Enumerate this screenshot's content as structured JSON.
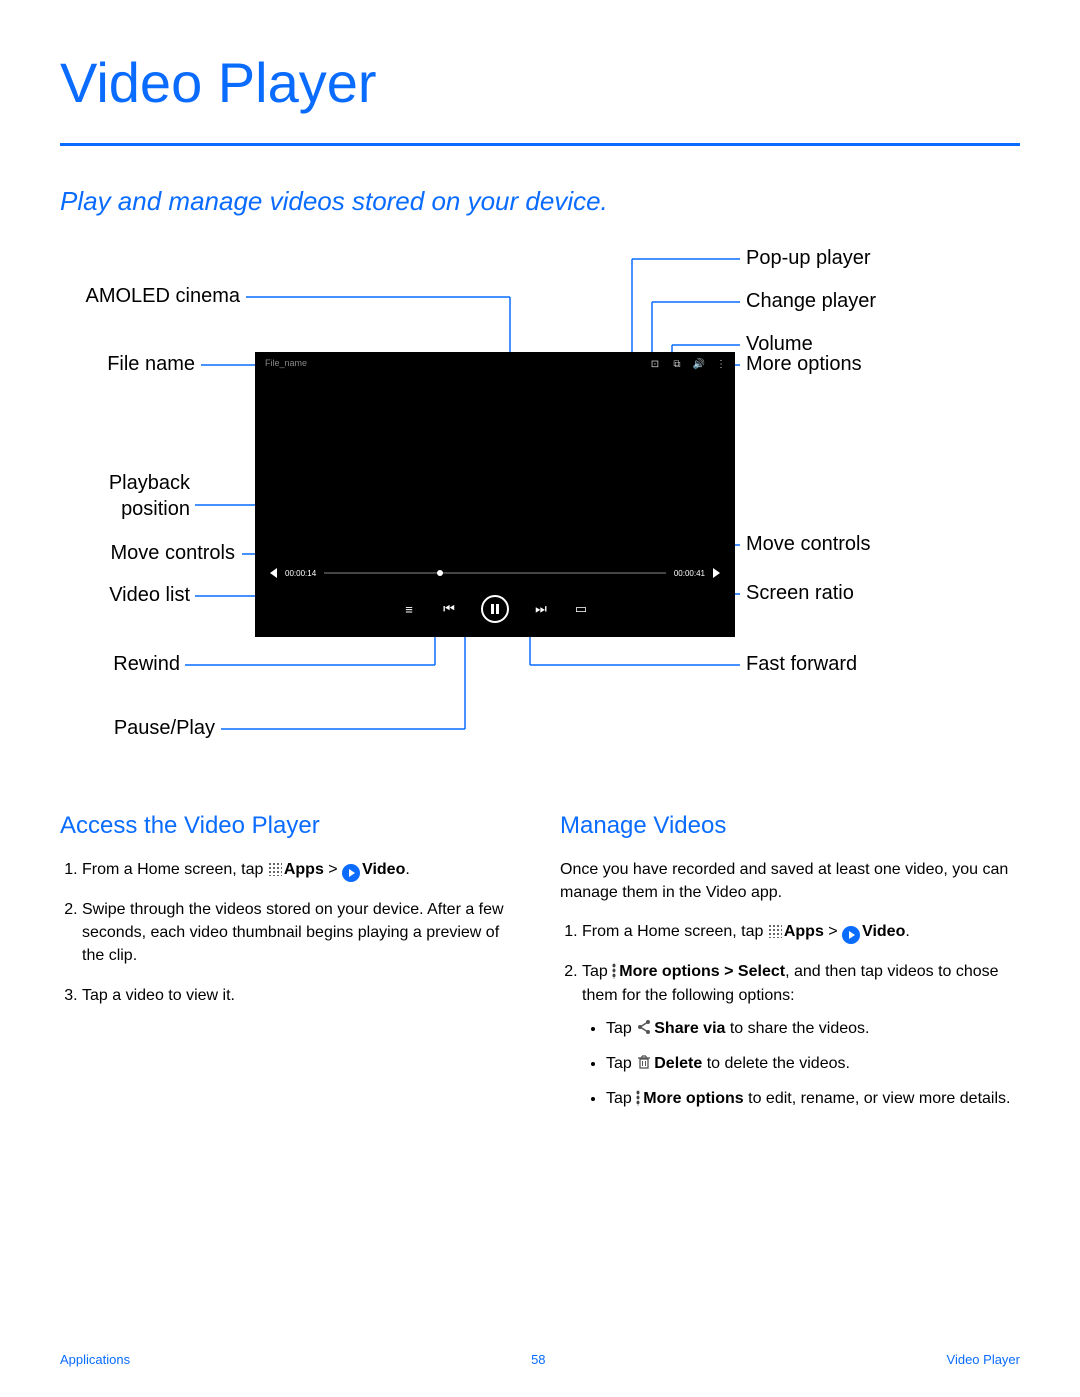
{
  "title": "Video Player",
  "subtitle": "Play and manage videos stored on your device.",
  "callouts": {
    "amoled": "AMOLED cinema",
    "filename": "File name",
    "playback": "Playback position",
    "move_l": "Move controls",
    "video_list": "Video list",
    "rewind": "Rewind",
    "pauseplay": "Pause/Play",
    "popup": "Pop-up player",
    "change_player": "Change player",
    "volume": "Volume",
    "more_options": "More options",
    "move_r": "Move controls",
    "screen_ratio": "Screen ratio",
    "fast_forward": "Fast forward"
  },
  "player": {
    "filename": "File_name",
    "time_current": "00:00:14",
    "time_total": "00:00:41"
  },
  "access": {
    "heading": "Access the Video Player",
    "step1_a": "From a Home screen, tap ",
    "apps": "Apps",
    "gt": " > ",
    "video": "Video",
    "step2": "Swipe through the videos stored on your device. After a few seconds, each video thumbnail begins playing a preview of the clip.",
    "step3": "Tap a video to view it."
  },
  "manage": {
    "heading": "Manage Videos",
    "intro": "Once you have recorded and saved at least one video, you can manage them in the Video app.",
    "step1_a": "From a Home screen, tap ",
    "step2_a": "Tap ",
    "more_sel": "More options > Select",
    "step2_b": ", and then tap videos to chose them for the following options:",
    "b1a": "Tap ",
    "share": "Share via",
    "b1b": " to share the videos.",
    "del": "Delete",
    "b2b": "  to delete the videos.",
    "more": "More options",
    "b3b": " to edit, rename, or view more details."
  },
  "footer": {
    "left": "Applications",
    "page": "58",
    "right": "Video Player"
  }
}
